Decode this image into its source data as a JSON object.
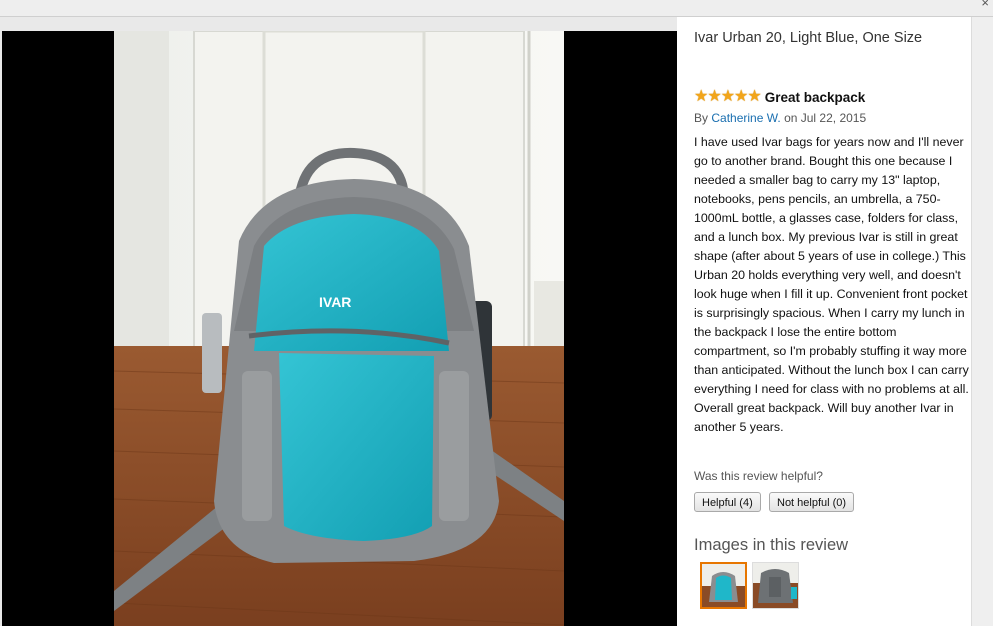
{
  "window": {
    "close_glyph": "×"
  },
  "product": {
    "title": "Ivar Urban 20, Light Blue, One Size"
  },
  "review": {
    "rating": 5,
    "rating_max": 5,
    "title": "Great backpack",
    "by_prefix": "By",
    "author": "Catherine W.",
    "date_text": "on Jul 22, 2015",
    "body": "I have used Ivar bags for years now and I'll never go to another brand. Bought this one because I needed a smaller bag to carry my 13\" laptop, notebooks, pens pencils, an umbrella, a 750-1000mL bottle, a glasses case, folders for class, and a lunch box. My previous Ivar is still in great shape (after about 5 years of use in college.) This Urban 20 holds everything very well, and doesn't look huge when I fill it up. Convenient front pocket is surprisingly spacious. When I carry my lunch in the backpack I lose the entire bottom compartment, so I'm probably stuffing it way more than anticipated. Without the lunch box I can carry everything I need for class with no problems at all. Overall great backpack. Will buy another Ivar in another 5 years."
  },
  "helpful": {
    "question": "Was this review helpful?",
    "helpful_label": "Helpful (4)",
    "not_helpful_label": "Not helpful (0)"
  },
  "images": {
    "heading": "Images in this review",
    "selected_index": 0,
    "count": 2
  },
  "photo_logo_text": "IVAR",
  "colors": {
    "star": "#f2a51a",
    "link": "#1a6fb0",
    "thumb_selected": "#e77600",
    "backpack_teal": "#1fb7c9",
    "backpack_gray": "#8a8d90",
    "floor": "#8a4b26"
  },
  "icons": {
    "star": "star-icon",
    "close": "close-icon"
  }
}
